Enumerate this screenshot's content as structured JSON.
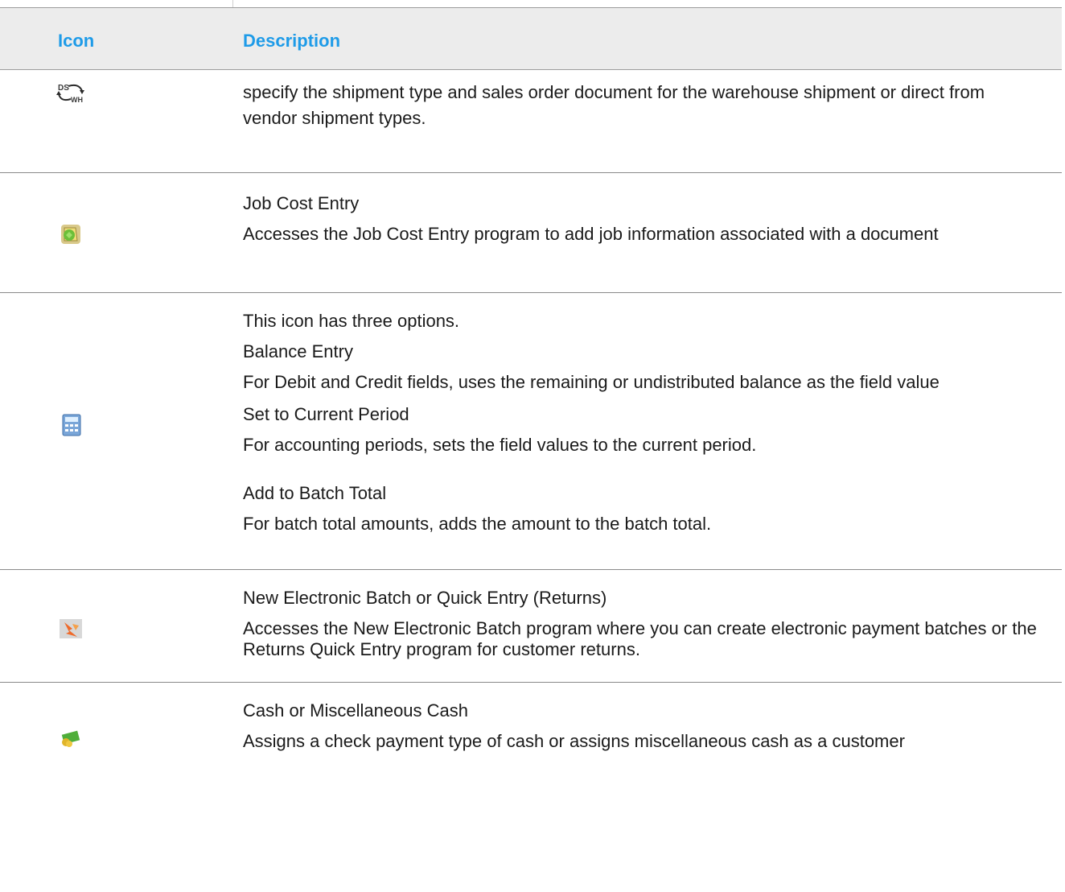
{
  "header": {
    "icon": "Icon",
    "description": "Description"
  },
  "rows": [
    {
      "icon": "ds-wh-shipment-swap-icon",
      "lines": [
        "specify the shipment type and sales order document for the warehouse shipment or direct from vendor shipment types."
      ]
    },
    {
      "icon": "job-cost-entry-icon",
      "lines": [
        "Job Cost Entry",
        "Accesses the Job Cost Entry program to add job information associated with a document"
      ]
    },
    {
      "icon": "calculator-icon",
      "lines": [
        "This icon has three options.",
        "Balance Entry",
        "For Debit and Credit fields, uses the remaining or undistributed balance as the field value",
        "Set to Current Period",
        "For accounting periods, sets the field values to the current period.",
        "Add to Batch Total",
        "For batch total amounts, adds the amount to the batch total."
      ]
    },
    {
      "icon": "new-electronic-batch-icon",
      "lines": [
        "New Electronic Batch or Quick Entry (Returns)",
        "Accesses the New Electronic Batch program where you can create electronic payment batches or the Returns Quick Entry program for customer returns."
      ]
    },
    {
      "icon": "cash-icon",
      "lines": [
        "Cash or Miscellaneous Cash",
        "Assigns a check payment type of cash or assigns miscellaneous cash as a customer"
      ]
    }
  ],
  "colors": {
    "header_text": "#1e9be8",
    "header_bg": "#ececec",
    "rule": "#8a8a8a"
  }
}
